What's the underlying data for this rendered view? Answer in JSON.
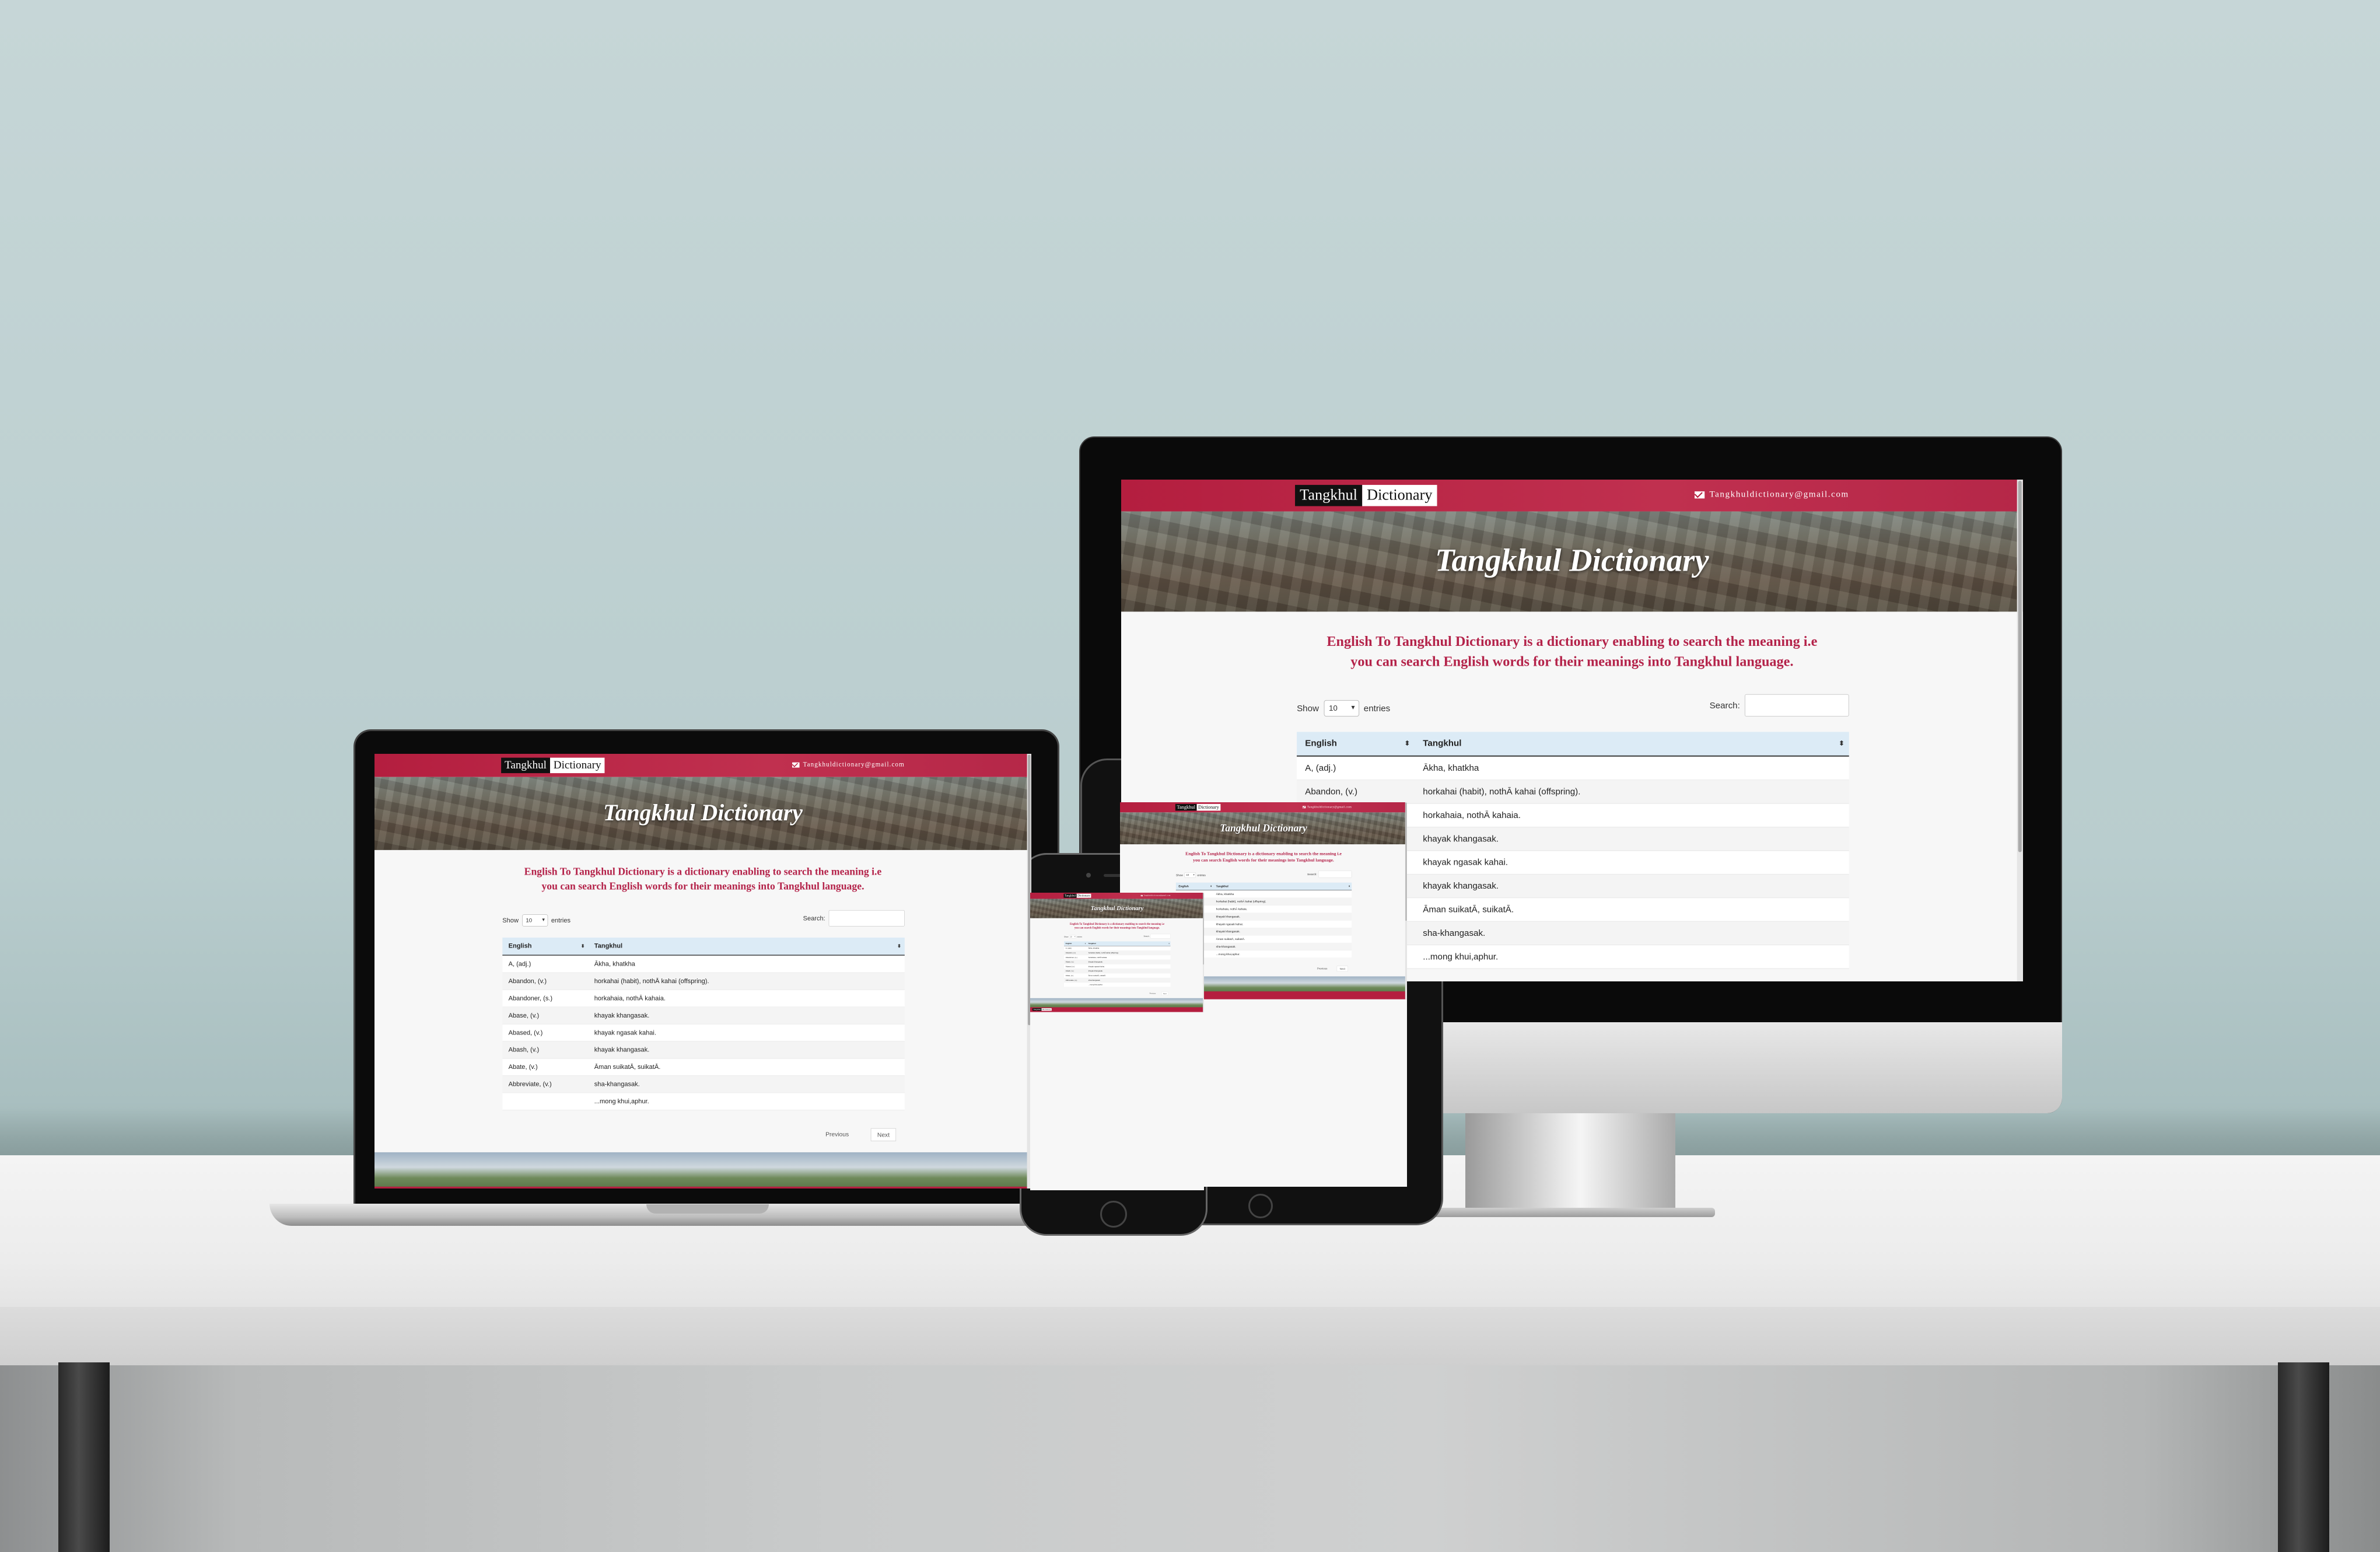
{
  "site": {
    "brand_part1": "Tangkhul",
    "brand_part2": "Dictionary",
    "email": "Tangkhuldictionary@gmail.com",
    "hero_title": "Tangkhul Dictionary",
    "intro_line1": "English To Tangkhul Dictionary is a dictionary enabling to search the meaning i.e",
    "intro_line2": "you can search English words for their meanings into Tangkhul language.",
    "show_label": "Show",
    "entries_value": "10",
    "entries_label": "entries",
    "search_label": "Search:",
    "columns": [
      "English",
      "Tangkhul"
    ],
    "rows": [
      {
        "english": "A, (adj.)",
        "tangkhul": "Ākha, khatkha"
      },
      {
        "english": "Abandon, (v.)",
        "tangkhul": "horkahai (habit), nothĀ kahai (offspring)."
      },
      {
        "english": "Abandoner, (s.)",
        "tangkhul": "horkahaia, nothĀ kahaia."
      },
      {
        "english": "Abase, (v.)",
        "tangkhul": "khayak khangasak."
      },
      {
        "english": "Abased, (v.)",
        "tangkhul": "khayak ngasak kahai."
      },
      {
        "english": "Abash, (v.)",
        "tangkhul": "khayak khangasak."
      },
      {
        "english": "Abate, (v.)",
        "tangkhul": "Āman suikatĀ, suikatĀ."
      },
      {
        "english": "Abbreviate, (v.)",
        "tangkhul": "sha-khangasak."
      },
      {
        "english": "",
        "tangkhul": "...mong khui,aphur."
      }
    ],
    "previous_label": "Previous",
    "next_label": "Next"
  },
  "colors": {
    "brand_red": "#b41e3f",
    "intro_text": "#b4234a",
    "table_header": "#dcebf6"
  }
}
